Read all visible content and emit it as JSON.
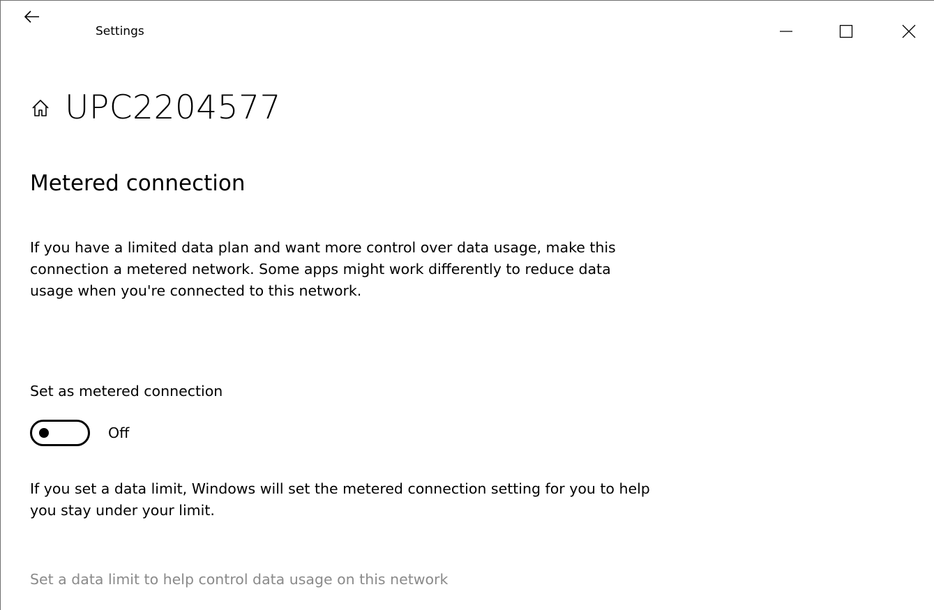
{
  "window": {
    "title": "Settings"
  },
  "header": {
    "title": "UPC2204577"
  },
  "metered": {
    "heading": "Metered connection",
    "description": "If you have a limited data plan and want more control over data usage, make this connection a metered network. Some apps might work differently to reduce data usage when you're connected to this network.",
    "toggle_label": "Set as metered connection",
    "toggle_state": "Off",
    "toggle_on": false,
    "limit_description": "If you set a data limit, Windows will set the metered connection setting for you to help you stay under your limit.",
    "limit_link": "Set a data limit to help control data usage on this network"
  },
  "colors": {
    "text": "#000000",
    "disabled_text": "#8a8a8a",
    "background": "#ffffff"
  },
  "icons": {
    "back": "arrow-left-icon",
    "home": "home-icon",
    "minimize": "minimize-icon",
    "maximize": "maximize-icon",
    "close": "close-icon"
  }
}
